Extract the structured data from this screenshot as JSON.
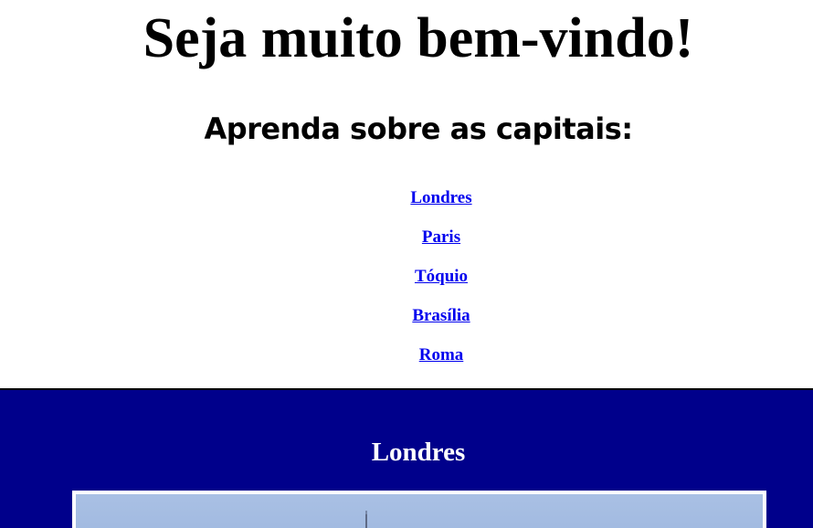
{
  "page": {
    "title": "Seja muito bem-vindo!",
    "subtitle": "Aprenda sobre as capitais:"
  },
  "nav": {
    "links": [
      "Londres",
      "Paris",
      "Tóquio",
      "Brasília",
      "Roma"
    ]
  },
  "section": {
    "title": "Londres",
    "image": "london-skyline-photo"
  },
  "colors": {
    "section_background": "#00008b",
    "link": "#0000ee",
    "sky": "#a9c0e4"
  }
}
